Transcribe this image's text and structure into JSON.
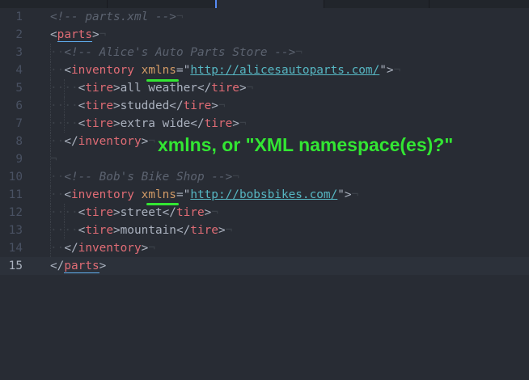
{
  "tabs": [
    "",
    "",
    "",
    "",
    ""
  ],
  "lines": [
    {
      "num": "1",
      "parts": [
        {
          "c": "comment",
          "t": "<!-- parts.xml -->"
        },
        {
          "c": "ws",
          "t": "¬"
        }
      ]
    },
    {
      "num": "2",
      "parts": [
        {
          "c": "punct",
          "t": "<"
        },
        {
          "c": "tag hl",
          "t": "parts"
        },
        {
          "c": "punct",
          "t": ">"
        },
        {
          "c": "ws",
          "t": "¬"
        }
      ]
    },
    {
      "num": "3",
      "parts": [
        {
          "c": "ws",
          "t": "··"
        },
        {
          "c": "comment",
          "t": "<!-- Alice's Auto Parts Store -->"
        },
        {
          "c": "ws",
          "t": "¬"
        }
      ]
    },
    {
      "num": "4",
      "parts": [
        {
          "c": "ws",
          "t": "··"
        },
        {
          "c": "punct",
          "t": "<"
        },
        {
          "c": "tag",
          "t": "inventory"
        },
        {
          "c": "punct",
          "t": " "
        },
        {
          "c": "attr",
          "t": "xmlns"
        },
        {
          "c": "punct",
          "t": "=\""
        },
        {
          "c": "url",
          "t": "http://alicesautoparts.com/"
        },
        {
          "c": "punct",
          "t": "\">"
        },
        {
          "c": "ws",
          "t": "¬"
        }
      ]
    },
    {
      "num": "5",
      "parts": [
        {
          "c": "ws",
          "t": "····"
        },
        {
          "c": "punct",
          "t": "<"
        },
        {
          "c": "tag",
          "t": "tire"
        },
        {
          "c": "punct",
          "t": ">all weather</"
        },
        {
          "c": "tag",
          "t": "tire"
        },
        {
          "c": "punct",
          "t": ">"
        },
        {
          "c": "ws",
          "t": "¬"
        }
      ]
    },
    {
      "num": "6",
      "parts": [
        {
          "c": "ws",
          "t": "····"
        },
        {
          "c": "punct",
          "t": "<"
        },
        {
          "c": "tag",
          "t": "tire"
        },
        {
          "c": "punct",
          "t": ">studded</"
        },
        {
          "c": "tag",
          "t": "tire"
        },
        {
          "c": "punct",
          "t": ">"
        },
        {
          "c": "ws",
          "t": "¬"
        }
      ]
    },
    {
      "num": "7",
      "parts": [
        {
          "c": "ws",
          "t": "····"
        },
        {
          "c": "punct",
          "t": "<"
        },
        {
          "c": "tag",
          "t": "tire"
        },
        {
          "c": "punct",
          "t": ">extra wide</"
        },
        {
          "c": "tag",
          "t": "tire"
        },
        {
          "c": "punct",
          "t": ">"
        },
        {
          "c": "ws",
          "t": "¬"
        }
      ]
    },
    {
      "num": "8",
      "parts": [
        {
          "c": "ws",
          "t": "··"
        },
        {
          "c": "punct",
          "t": "</"
        },
        {
          "c": "tag",
          "t": "inventory"
        },
        {
          "c": "punct",
          "t": ">"
        },
        {
          "c": "ws",
          "t": "¬"
        }
      ]
    },
    {
      "num": "9",
      "parts": [
        {
          "c": "ws",
          "t": "¬"
        }
      ]
    },
    {
      "num": "10",
      "parts": [
        {
          "c": "ws",
          "t": "··"
        },
        {
          "c": "comment",
          "t": "<!-- Bob's Bike Shop -->"
        },
        {
          "c": "ws",
          "t": "¬"
        }
      ]
    },
    {
      "num": "11",
      "parts": [
        {
          "c": "ws",
          "t": "··"
        },
        {
          "c": "punct",
          "t": "<"
        },
        {
          "c": "tag",
          "t": "inventory"
        },
        {
          "c": "punct",
          "t": " "
        },
        {
          "c": "attr",
          "t": "xmlns"
        },
        {
          "c": "punct",
          "t": "=\""
        },
        {
          "c": "url",
          "t": "http://bobsbikes.com/"
        },
        {
          "c": "punct",
          "t": "\">"
        },
        {
          "c": "ws",
          "t": "¬"
        }
      ]
    },
    {
      "num": "12",
      "parts": [
        {
          "c": "ws",
          "t": "····"
        },
        {
          "c": "punct",
          "t": "<"
        },
        {
          "c": "tag",
          "t": "tire"
        },
        {
          "c": "punct",
          "t": ">street</"
        },
        {
          "c": "tag",
          "t": "tire"
        },
        {
          "c": "punct",
          "t": ">"
        },
        {
          "c": "ws",
          "t": "¬"
        }
      ]
    },
    {
      "num": "13",
      "parts": [
        {
          "c": "ws",
          "t": "····"
        },
        {
          "c": "punct",
          "t": "<"
        },
        {
          "c": "tag",
          "t": "tire"
        },
        {
          "c": "punct",
          "t": ">mountain</"
        },
        {
          "c": "tag",
          "t": "tire"
        },
        {
          "c": "punct",
          "t": ">"
        },
        {
          "c": "ws",
          "t": "¬"
        }
      ]
    },
    {
      "num": "14",
      "parts": [
        {
          "c": "ws",
          "t": "··"
        },
        {
          "c": "punct",
          "t": "</"
        },
        {
          "c": "tag",
          "t": "inventory"
        },
        {
          "c": "punct",
          "t": ">"
        },
        {
          "c": "ws",
          "t": "¬"
        }
      ]
    },
    {
      "num": "15",
      "current": true,
      "parts": [
        {
          "c": "punct",
          "t": "</"
        },
        {
          "c": "tag hl",
          "t": "parts"
        },
        {
          "c": "punct",
          "t": ">"
        }
      ]
    }
  ],
  "annotation": {
    "text": "xmlns, or \"XML namespace(es)?\"",
    "color": "#33e633"
  },
  "colors": {
    "background": "#282c34",
    "tag": "#e06c75",
    "attribute": "#d19a66",
    "url": "#56b6c2",
    "comment": "#5c6370"
  }
}
